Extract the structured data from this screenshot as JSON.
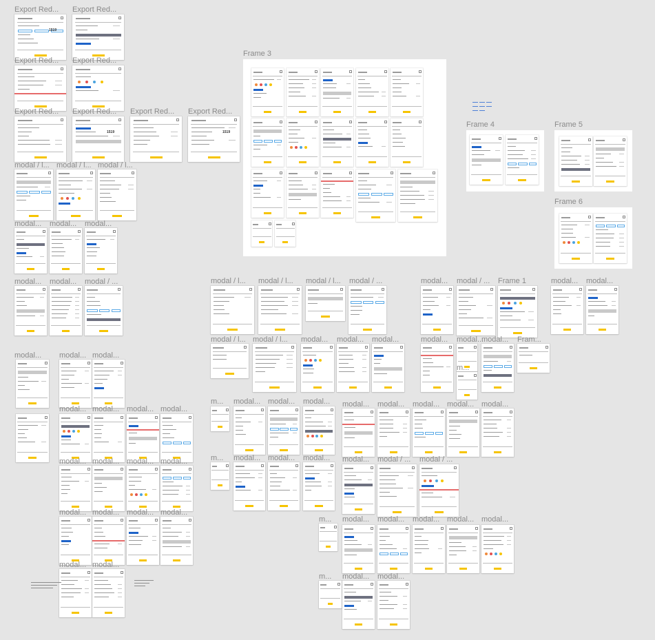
{
  "canvas": {
    "background": "#e5e5e5",
    "accent": "#f6c400",
    "link_blue": "#1e63c8"
  },
  "labels": {
    "export_red": "Export Red...",
    "modal_l": "modal / l...",
    "modal_dots": "modal...",
    "modal_slash": "modal / ...",
    "m_dots": "m...",
    "frame3": "Frame 3",
    "frame4": "Frame 4",
    "frame5": "Frame 5",
    "frame6": "Frame 6",
    "frame1": "Frame 1",
    "fram": "Fram..."
  }
}
